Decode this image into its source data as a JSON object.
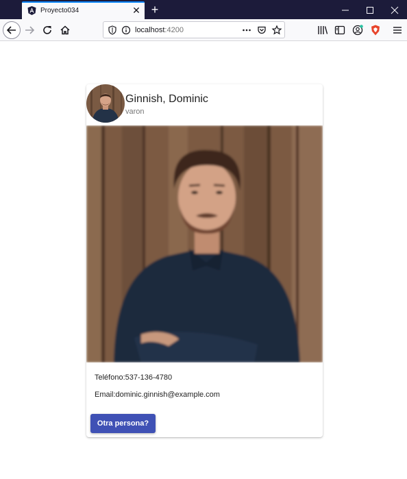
{
  "browser": {
    "tab_title": "Proyecto034",
    "url_host": "localhost",
    "url_port": ":4200"
  },
  "card": {
    "title": "Ginnish, Dominic",
    "subtitle": "varon",
    "phone_line": "Teléfono:537-136-4780",
    "email_line": "Email:dominic.ginnish@example.com",
    "button_label": "Otra persona?"
  },
  "colors": {
    "accent": "#3f51b5",
    "tabbar": "#1c1b3a",
    "firefox_blue": "#0a84ff"
  },
  "icons": [
    "angular-icon",
    "close-icon",
    "plus-icon",
    "minimize-icon",
    "maximize-icon",
    "close-window-icon",
    "back-arrow-icon",
    "forward-arrow-icon",
    "reload-icon",
    "home-icon",
    "shield-icon",
    "info-icon",
    "more-icon",
    "pocket-icon",
    "star-icon",
    "library-icon",
    "sidebar-icon",
    "account-icon",
    "brave-icon",
    "menu-icon"
  ]
}
